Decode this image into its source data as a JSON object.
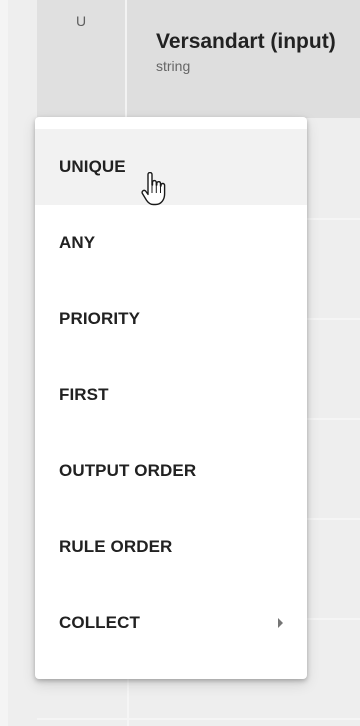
{
  "table": {
    "hit_policy_letter": "U",
    "input_column": {
      "title": "Versandart (input)",
      "type": "string"
    }
  },
  "menu": {
    "items": [
      {
        "label": "UNIQUE",
        "state": "hovered"
      },
      {
        "label": "ANY"
      },
      {
        "label": "PRIORITY"
      },
      {
        "label": "FIRST"
      },
      {
        "label": "OUTPUT ORDER"
      },
      {
        "label": "RULE ORDER"
      },
      {
        "label": "COLLECT",
        "has_submenu": true
      }
    ]
  },
  "cursor": {
    "icon": "hand-pointer-icon"
  }
}
